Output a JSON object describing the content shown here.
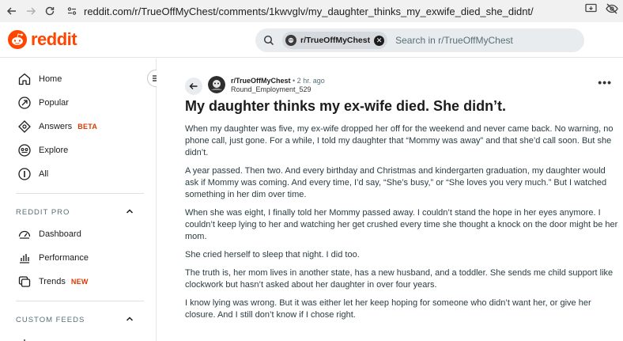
{
  "browser": {
    "url": "reddit.com/r/TrueOffMyChest/comments/1kwvglv/my_daughter_thinks_my_exwife_died_she_didnt/"
  },
  "header": {
    "logo_text": "reddit",
    "search": {
      "chip_label": "r/TrueOffMyChest",
      "placeholder": "Search in r/TrueOffMyChest"
    }
  },
  "sidebar": {
    "nav": [
      {
        "label": "Home",
        "icon": "home-icon"
      },
      {
        "label": "Popular",
        "icon": "popular-icon"
      },
      {
        "label": "Answers",
        "badge": "BETA",
        "icon": "answers-icon"
      },
      {
        "label": "Explore",
        "icon": "explore-icon"
      },
      {
        "label": "All",
        "icon": "all-icon"
      }
    ],
    "reddit_pro": {
      "heading": "REDDIT PRO",
      "items": [
        {
          "label": "Dashboard",
          "icon": "dashboard-icon"
        },
        {
          "label": "Performance",
          "icon": "performance-icon"
        },
        {
          "label": "Trends",
          "badge": "NEW",
          "icon": "trends-icon"
        }
      ]
    },
    "custom_feeds": {
      "heading": "CUSTOM FEEDS"
    }
  },
  "post": {
    "subreddit": "r/TrueOffMyChest",
    "time": "• 2 hr. ago",
    "author": "Round_Employment_529",
    "title": "My daughter thinks my ex-wife died. She didn’t.",
    "paragraphs": [
      "When my daughter was five, my ex-wife dropped her off for the weekend and never came back. No warning, no phone call, just gone. For a while, I told my daughter that “Mommy was away” and that she’d call soon. But she didn’t.",
      "A year passed. Then two. And every birthday and Christmas and kindergarten graduation, my daughter would ask if Mommy was coming. And every time, I’d say, “She’s busy,” or “She loves you very much.” But I watched something in her dim over time.",
      "When she was eight, I finally told her Mommy passed away. I couldn’t stand the hope in her eyes anymore. I couldn’t keep lying to her and watching her get crushed every time she thought a knock on the door might be her mom.",
      "She cried herself to sleep that night. I did too.",
      "The truth is, her mom lives in another state, has a new husband, and a toddler. She sends me child support like clockwork but hasn’t asked about her daughter in over four years.",
      "I know lying was wrong. But it was either let her keep hoping for someone who didn’t want her, or give her closure. And I still don’t know if I chose right."
    ]
  },
  "colors": {
    "brand": "#ff4500",
    "badge": "#d93a00"
  }
}
